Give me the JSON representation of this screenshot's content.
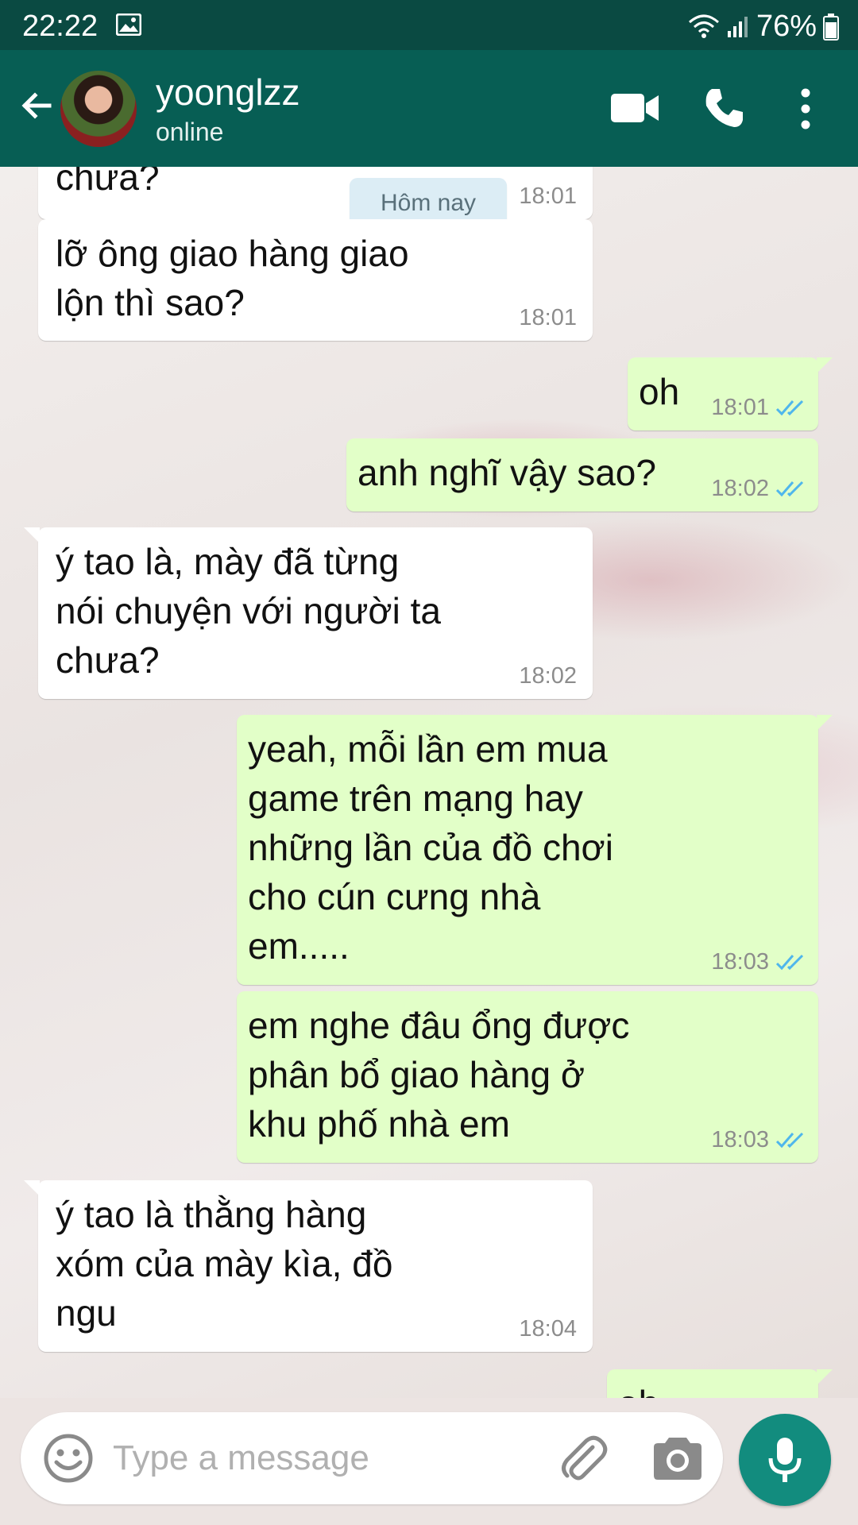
{
  "status_bar": {
    "time": "22:22",
    "battery": "76%"
  },
  "header": {
    "contact_name": "yoonglzz",
    "contact_status": "online"
  },
  "chat": {
    "date_chip": "Hôm nay",
    "messages": [
      {
        "direction": "in",
        "text": "chưa?",
        "time": "18:01"
      },
      {
        "direction": "in",
        "text": "lỡ ông giao hàng giao\nlộn thì sao?",
        "time": "18:01"
      },
      {
        "direction": "out",
        "text": "oh",
        "time": "18:01"
      },
      {
        "direction": "out",
        "text": "anh nghĩ vậy sao?",
        "time": "18:02"
      },
      {
        "direction": "in",
        "text": "ý tao là, mày đã từng\nnói chuyện với người ta\nchưa?",
        "time": "18:02"
      },
      {
        "direction": "out",
        "text": "yeah, mỗi lần em mua\ngame trên mạng hay\nnhững lần của đồ chơi\ncho cún cưng nhà\nem.....",
        "time": "18:03"
      },
      {
        "direction": "out",
        "text": "em nghe đâu ổng được\nphân bổ giao hàng ở\nkhu phố nhà em",
        "time": "18:03"
      },
      {
        "direction": "in",
        "text": "ý tao là thằng hàng\nxóm của mày kìa, đồ\nngu",
        "time": "18:04"
      },
      {
        "direction": "out",
        "text": "oh",
        "time": ""
      }
    ]
  },
  "composer": {
    "placeholder": "Type a message"
  },
  "icons": {
    "back": "arrow-left-icon",
    "video": "video-camera-icon",
    "call": "phone-icon",
    "menu": "more-vertical-icon",
    "emoji": "emoji-icon",
    "attach": "paperclip-icon",
    "camera": "camera-icon",
    "mic": "microphone-icon"
  },
  "colors": {
    "header": "#075e54",
    "status_bar": "#0a4a42",
    "outgoing_bubble": "#e2ffc8",
    "incoming_bubble": "#ffffff",
    "read_ticks": "#4fb6ec",
    "mic_button": "#128c7e",
    "date_chip": "#dcedf5"
  }
}
